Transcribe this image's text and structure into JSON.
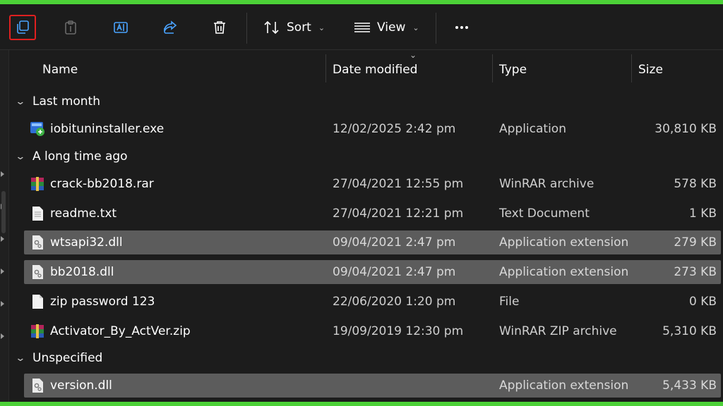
{
  "toolbar": {
    "sort_label": "Sort",
    "view_label": "View",
    "buttons": [
      "copy-icon",
      "paste-icon",
      "rename-icon",
      "share-icon",
      "delete-icon",
      "sort-icon",
      "view-icon",
      "more-icon"
    ]
  },
  "columns": {
    "name": "Name",
    "date": "Date modified",
    "type": "Type",
    "size": "Size"
  },
  "groups": [
    {
      "label": "Last month"
    },
    {
      "label": "A long time ago"
    },
    {
      "label": "Unspecified"
    }
  ],
  "files": [
    {
      "name": "iobituninstaller.exe",
      "date": "12/02/2025 2:42 pm",
      "type": "Application",
      "size": "30,810 KB",
      "icon": "exe-installer-icon",
      "selected": false
    },
    {
      "name": "crack-bb2018.rar",
      "date": "27/04/2021 12:55 pm",
      "type": "WinRAR archive",
      "size": "578 KB",
      "icon": "winrar-icon",
      "selected": false
    },
    {
      "name": "readme.txt",
      "date": "27/04/2021 12:21 pm",
      "type": "Text Document",
      "size": "1 KB",
      "icon": "text-file-icon",
      "selected": false
    },
    {
      "name": "wtsapi32.dll",
      "date": "09/04/2021 2:47 pm",
      "type": "Application extension",
      "size": "279 KB",
      "icon": "dll-file-icon",
      "selected": true
    },
    {
      "name": "bb2018.dll",
      "date": "09/04/2021 2:47 pm",
      "type": "Application extension",
      "size": "273 KB",
      "icon": "dll-file-icon",
      "selected": true
    },
    {
      "name": "zip password 123",
      "date": "22/06/2020 1:20 pm",
      "type": "File",
      "size": "0 KB",
      "icon": "blank-file-icon",
      "selected": false
    },
    {
      "name": "Activator_By_ActVer.zip",
      "date": "19/09/2019 12:30 pm",
      "type": "WinRAR ZIP archive",
      "size": "5,310 KB",
      "icon": "winrar-icon",
      "selected": false
    },
    {
      "name": "version.dll",
      "date": "",
      "type": "Application extension",
      "size": "5,433 KB",
      "icon": "dll-file-icon",
      "selected": true
    }
  ],
  "colors": {
    "frame": "#4cd137",
    "background": "#1c1c1c",
    "selection": "#5c5c5c",
    "highlight_outline": "#e02020"
  }
}
